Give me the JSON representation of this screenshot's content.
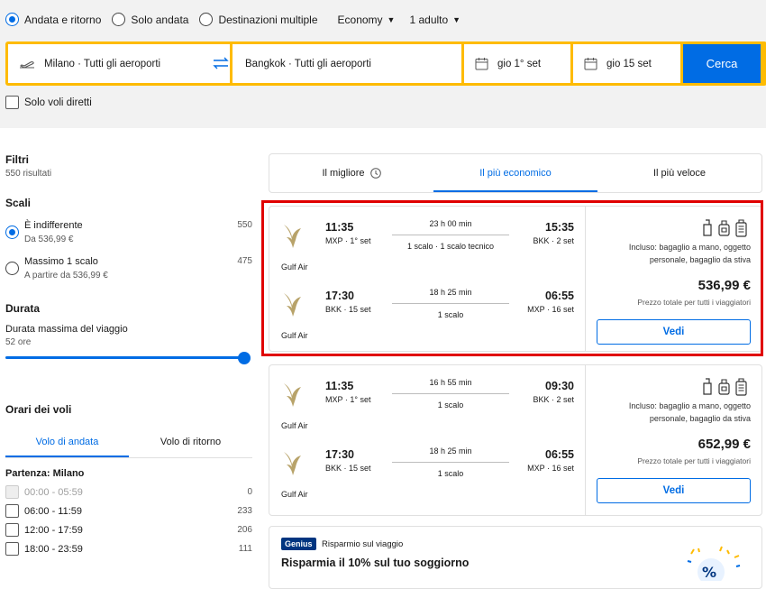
{
  "trip_type": {
    "options": [
      "Andata e ritorno",
      "Solo andata",
      "Destinazioni multiple"
    ],
    "selected": 0
  },
  "cabin_class": "Economy",
  "passengers": "1 adulto",
  "search": {
    "origin": "Milano · Tutti gli aeroporti",
    "destination": "Bangkok · Tutti gli aeroporti",
    "depart_date": "gio 1° set",
    "return_date": "gio 15 set",
    "button": "Cerca"
  },
  "direct_only_label": "Solo voli diretti",
  "filters": {
    "title": "Filtri",
    "results": "550 risultati",
    "stops": {
      "title": "Scali",
      "options": [
        {
          "label": "È indifferente",
          "sub": "Da 536,99 €",
          "count": "550",
          "selected": true
        },
        {
          "label": "Massimo 1 scalo",
          "sub": "A partire da 536,99 €",
          "count": "475",
          "selected": false
        }
      ]
    },
    "duration": {
      "title": "Durata",
      "label": "Durata massima del viaggio",
      "value": "52 ore",
      "slider_fraction": 1.0
    },
    "times": {
      "title": "Orari dei voli",
      "tabs": [
        "Volo di andata",
        "Volo di ritorno"
      ],
      "active_tab": 0,
      "subtitle": "Partenza: Milano",
      "rows": [
        {
          "label": "00:00 - 05:59",
          "count": "0",
          "disabled": true
        },
        {
          "label": "06:00 - 11:59",
          "count": "233",
          "disabled": false
        },
        {
          "label": "12:00 - 17:59",
          "count": "206",
          "disabled": false
        },
        {
          "label": "18:00 - 23:59",
          "count": "111",
          "disabled": false
        }
      ]
    }
  },
  "sort_tabs": [
    "Il migliore",
    "Il più economico",
    "Il più veloce"
  ],
  "sort_active": 1,
  "results": [
    {
      "legs": [
        {
          "airline": "Gulf Air",
          "dep_time": "11:35",
          "dep_info": "MXP · 1° set",
          "duration": "23 h 00 min",
          "stops": "1 scalo · 1 scalo tecnico",
          "arr_time": "15:35",
          "arr_info": "BKK · 2 set"
        },
        {
          "airline": "Gulf Air",
          "dep_time": "17:30",
          "dep_info": "BKK · 15 set",
          "duration": "18 h 25 min",
          "stops": "1 scalo",
          "arr_time": "06:55",
          "arr_info": "MXP · 16 set"
        }
      ],
      "included": "Incluso: bagaglio a mano, oggetto personale, bagaglio da stiva",
      "price": "536,99 €",
      "price_note": "Prezzo totale per tutti i viaggiatori",
      "button": "Vedi"
    },
    {
      "legs": [
        {
          "airline": "Gulf Air",
          "dep_time": "11:35",
          "dep_info": "MXP · 1° set",
          "duration": "16 h 55 min",
          "stops": "1 scalo",
          "arr_time": "09:30",
          "arr_info": "BKK · 2 set"
        },
        {
          "airline": "Gulf Air",
          "dep_time": "17:30",
          "dep_info": "BKK · 15 set",
          "duration": "18 h 25 min",
          "stops": "1 scalo",
          "arr_time": "06:55",
          "arr_info": "MXP · 16 set"
        }
      ],
      "included": "Incluso: bagaglio a mano, oggetto personale, bagaglio da stiva",
      "price": "652,99 €",
      "price_note": "Prezzo totale per tutti i viaggiatori",
      "button": "Vedi"
    }
  ],
  "promo": {
    "badge": "Genius",
    "tag": "Risparmio sul viaggio",
    "title": "Risparmia il 10% sul tuo soggiorno"
  },
  "colors": {
    "accent": "#006ce4",
    "search_border": "#febb02",
    "highlight": "#e00000",
    "genius": "#003580"
  }
}
